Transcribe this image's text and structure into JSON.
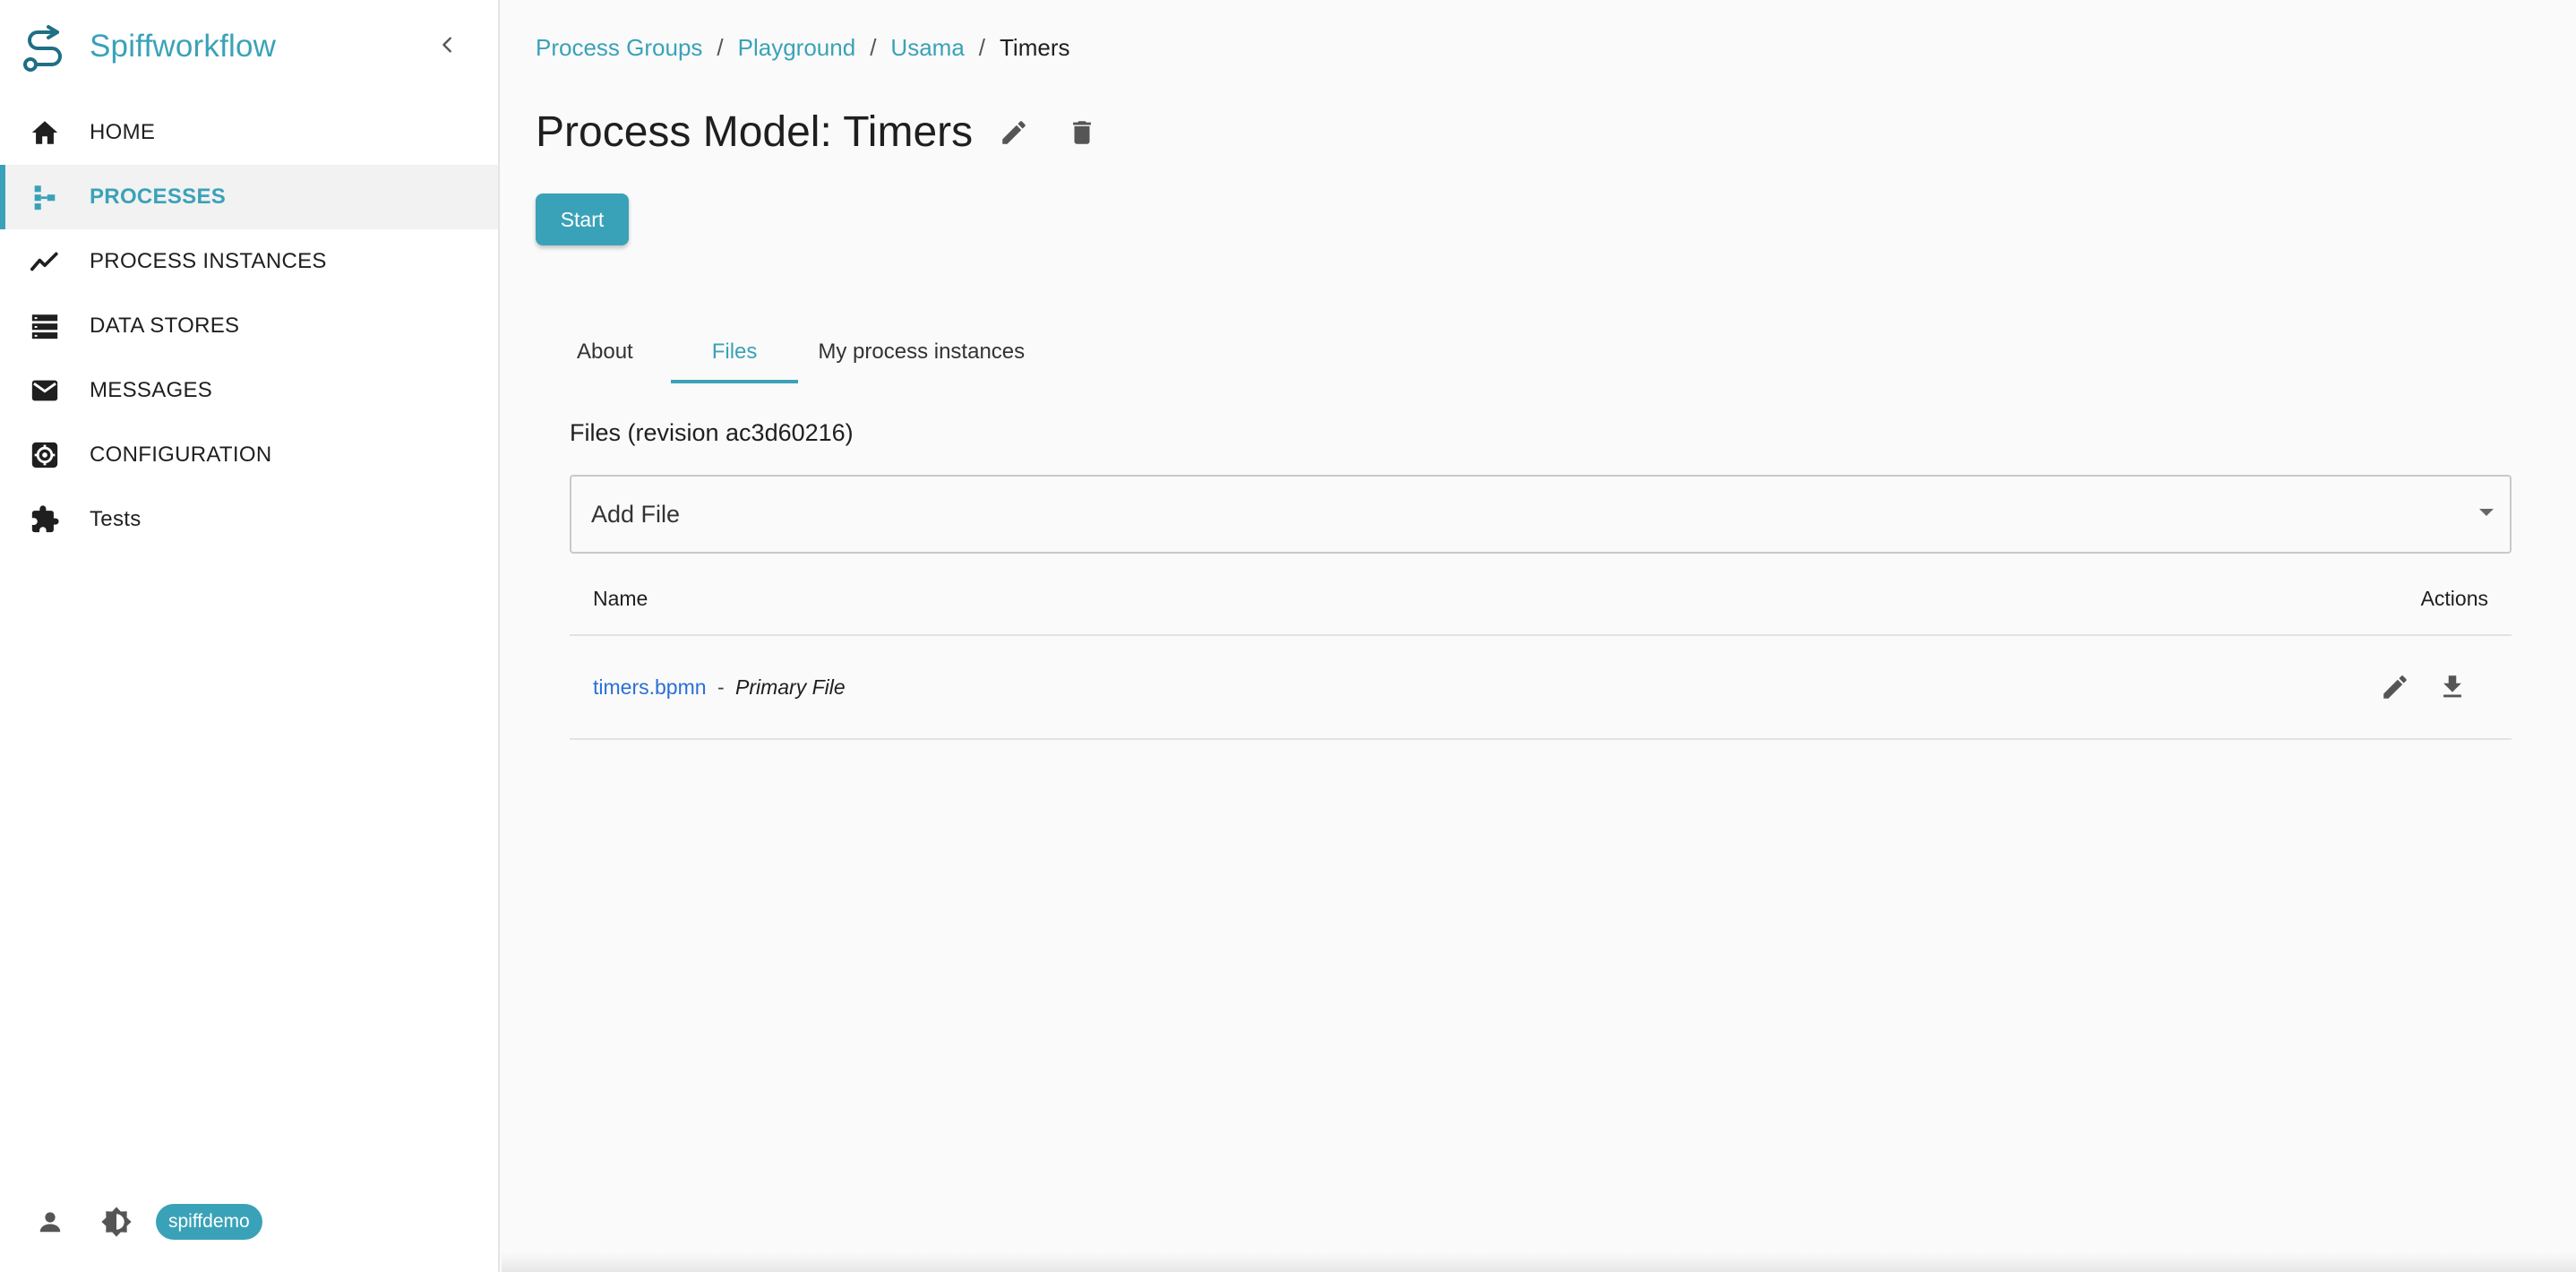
{
  "brand": {
    "name": "Spiffworkflow",
    "logo_icon": "spiffworkflow-logo-icon",
    "accent_color": "#3aa2b8"
  },
  "sidebar": {
    "collapse_icon": "chevron-left-icon",
    "items": [
      {
        "label": "HOME",
        "icon": "home-icon",
        "active": false
      },
      {
        "label": "PROCESSES",
        "icon": "process-tree-icon",
        "active": true
      },
      {
        "label": "PROCESS INSTANCES",
        "icon": "line-chart-icon",
        "active": false
      },
      {
        "label": "DATA STORES",
        "icon": "storage-icon",
        "active": false
      },
      {
        "label": "MESSAGES",
        "icon": "envelope-icon",
        "active": false
      },
      {
        "label": "CONFIGURATION",
        "icon": "settings-icon",
        "active": false
      },
      {
        "label": "Tests",
        "icon": "puzzle-icon",
        "active": false
      }
    ],
    "footer": {
      "user_icon": "person-icon",
      "theme_icon": "brightness-icon",
      "username": "spiffdemo"
    }
  },
  "breadcrumb": {
    "items": [
      "Process Groups",
      "Playground",
      "Usama"
    ],
    "separator": "/",
    "current": "Timers"
  },
  "page": {
    "title": "Process Model: Timers",
    "edit_icon": "pencil-icon",
    "delete_icon": "trash-icon",
    "start_label": "Start"
  },
  "tabs": [
    {
      "label": "About",
      "active": false
    },
    {
      "label": "Files",
      "active": true
    },
    {
      "label": "My process instances",
      "active": false
    }
  ],
  "files": {
    "heading": "Files (revision ac3d60216)",
    "add_file_label": "Add File",
    "columns": {
      "name": "Name",
      "actions": "Actions"
    },
    "rows": [
      {
        "file_name": "timers.bpmn",
        "separator": "-",
        "note": "Primary File",
        "actions": [
          "pencil-icon",
          "download-icon"
        ]
      }
    ]
  }
}
